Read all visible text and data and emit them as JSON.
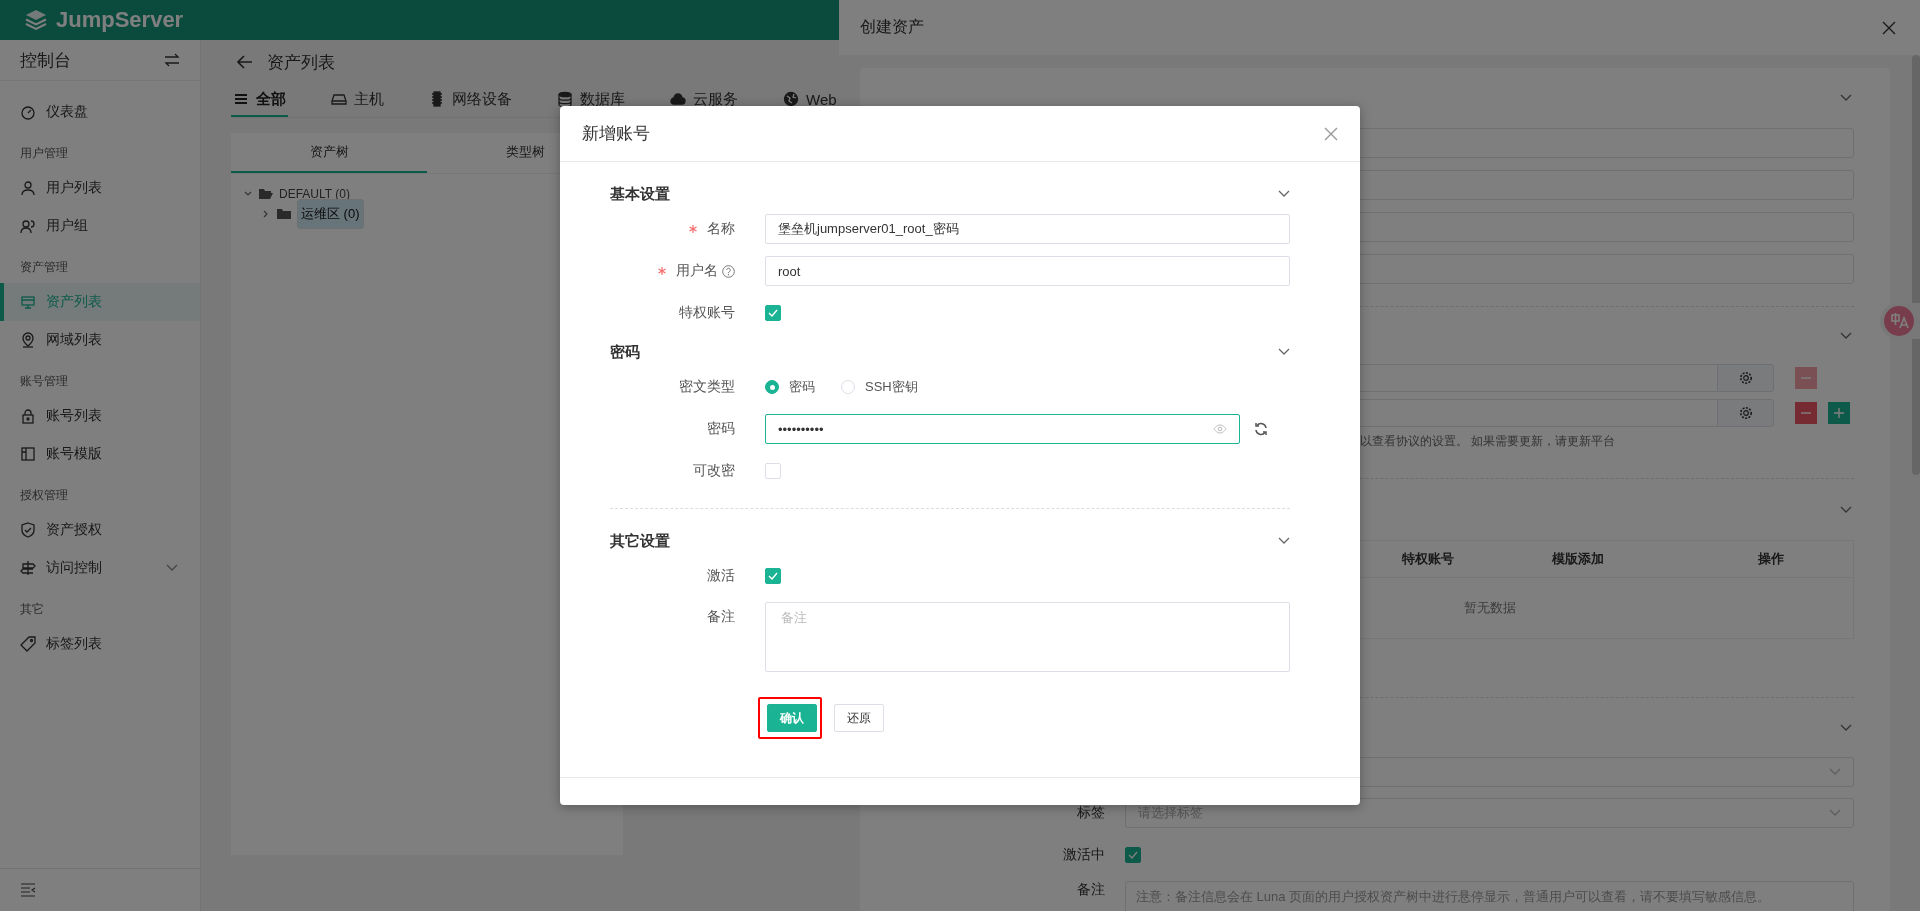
{
  "header": {
    "logo": "JumpServer"
  },
  "sidebar": {
    "title": "控制台",
    "groups": [
      {
        "items": [
          {
            "label": "仪表盘",
            "kind": "link",
            "selected": false
          }
        ]
      },
      {
        "heading": "用户管理",
        "items": [
          {
            "label": "用户列表",
            "kind": "link",
            "selected": false
          },
          {
            "label": "用户组",
            "kind": "link",
            "selected": false
          }
        ]
      },
      {
        "heading": "资产管理",
        "items": [
          {
            "label": "资产列表",
            "kind": "link",
            "selected": true
          },
          {
            "label": "网域列表",
            "kind": "link",
            "selected": false
          }
        ]
      },
      {
        "heading": "账号管理",
        "items": [
          {
            "label": "账号列表",
            "kind": "link",
            "selected": false
          },
          {
            "label": "账号模版",
            "kind": "link",
            "selected": false
          }
        ]
      },
      {
        "heading": "授权管理",
        "items": [
          {
            "label": "资产授权",
            "kind": "link",
            "selected": false
          },
          {
            "label": "访问控制",
            "kind": "submenu",
            "selected": false
          }
        ]
      },
      {
        "heading": "其它",
        "items": [
          {
            "label": "标签列表",
            "kind": "link",
            "selected": false
          }
        ]
      }
    ]
  },
  "page": {
    "title": "资产列表",
    "tabs": [
      {
        "label": "全部",
        "selected": true
      },
      {
        "label": "主机",
        "selected": false
      },
      {
        "label": "网络设备",
        "selected": false
      },
      {
        "label": "数据库",
        "selected": false
      },
      {
        "label": "云服务",
        "selected": false
      },
      {
        "label": "Web",
        "selected": false
      }
    ],
    "tree_tabs": [
      {
        "label": "资产树",
        "selected": true
      },
      {
        "label": "类型树",
        "selected": false
      }
    ],
    "tree": [
      {
        "label": "DEFAULT (0)",
        "expanded": true,
        "selected": false,
        "children": [
          {
            "label": "运维区 (0)",
            "expanded": false,
            "selected": true
          }
        ]
      }
    ]
  },
  "drawer": {
    "title": "创建资产",
    "protocols": [
      {
        "remove_disabled": true,
        "can_add": false
      },
      {
        "remove_disabled": false,
        "can_add": true
      }
    ],
    "protocol_hint": "以查看协议的设置。 如果需要更新，请更新平台",
    "accounts_table": {
      "columns": [
        "特权账号",
        "模版添加",
        "操作"
      ],
      "empty_text": "暂无数据"
    },
    "other_fields": [
      {
        "kind": "select"
      },
      {
        "kind": "select",
        "label": "标签",
        "placeholder": "请选择标签"
      },
      {
        "kind": "checkbox",
        "label": "激活中",
        "checked": true
      },
      {
        "kind": "textarea",
        "label": "备注",
        "placeholder": "注意：备注信息会在 Luna 页面的用户授权资产树中进行悬停显示，普通用户可以查看，请不要填写敏感信息。"
      }
    ]
  },
  "modal": {
    "title": "新增账号",
    "sections": [
      {
        "title": "基本设置",
        "separated": false,
        "fields": [
          {
            "kind": "text",
            "label": "名称",
            "required": true,
            "help": false,
            "value": "堡垒机jumpserver01_root_密码"
          },
          {
            "kind": "text",
            "label": "用户名",
            "required": true,
            "help": true,
            "value": "root"
          },
          {
            "kind": "checkbox",
            "label": "特权账号",
            "checked": true
          }
        ]
      },
      {
        "title": "密码",
        "separated": false,
        "fields": [
          {
            "kind": "radio",
            "label": "密文类型",
            "options": [
              {
                "label": "密码",
                "selected": true
              },
              {
                "label": "SSH密钥",
                "selected": false
              }
            ]
          },
          {
            "kind": "password",
            "label": "密码",
            "value": "••••••••••",
            "focused": true
          },
          {
            "kind": "checkbox",
            "label": "可改密",
            "checked": false
          }
        ]
      },
      {
        "title": "其它设置",
        "separated": true,
        "fields": [
          {
            "kind": "checkbox",
            "label": "激活",
            "checked": true
          },
          {
            "kind": "textarea",
            "label": "备注",
            "placeholder": "备注"
          }
        ]
      }
    ],
    "buttons": [
      {
        "label": "确认",
        "kind": "primary",
        "highlighted": true
      },
      {
        "label": "还原",
        "kind": "default",
        "highlighted": false
      }
    ]
  }
}
